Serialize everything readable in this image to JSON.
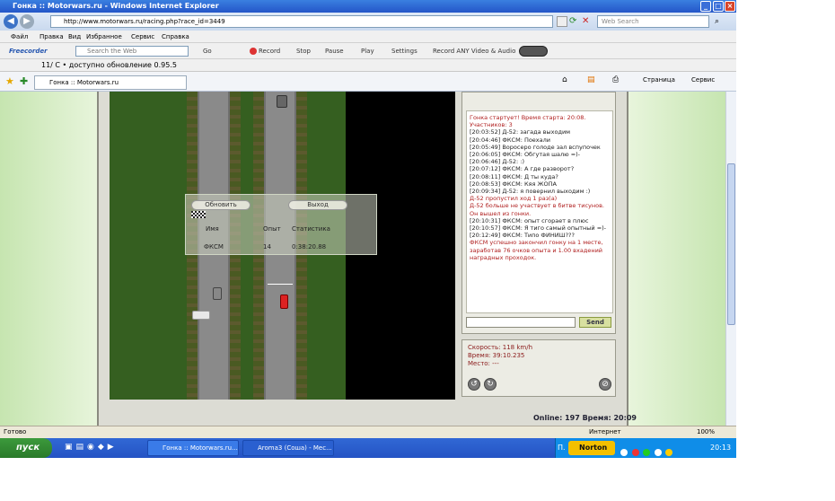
{
  "window": {
    "title": "Гонка :: Motorwars.ru - Windows Internet Explorer"
  },
  "address": {
    "url": "http://www.motorwars.ru/racing.php?race_id=3449",
    "search_placeholder": "Web Search"
  },
  "menu": [
    "Файл",
    "Правка",
    "Вид",
    "Избранное",
    "Сервис",
    "Справка"
  ],
  "toolbar": {
    "brand": "Freecorder",
    "search_placeholder": "Search the Web",
    "go": "Go",
    "record": "Record",
    "stop": "Stop",
    "pause": "Pause",
    "play": "Play",
    "settings": "Settings",
    "record_any": "Record ANY Video & Audio"
  },
  "update_bar": {
    "text": "11/ C • доступно обновление 0.95.5"
  },
  "tab": {
    "label": "Гонка :: Motorwars.ru"
  },
  "cmdbar": {
    "page": "Страница",
    "service": "Сервис"
  },
  "popup": {
    "refresh": "Обновить",
    "exit": "Выход",
    "col_name": "Имя",
    "col_exp": "Опыт",
    "col_stat": "Статистика",
    "row_name": "ФКСМ",
    "row_exp": "14",
    "row_stat": "0:38:20.88"
  },
  "chat": {
    "lines": [
      {
        "t": "Гонка стартует! Время старта: 20:08.",
        "r": true
      },
      {
        "t": "Участников: 3",
        "r": true
      },
      {
        "t": "[20:03:52] Д-52: загада выходим",
        "r": false
      },
      {
        "t": "[20:04:46] ФКСМ: Поехали",
        "r": false
      },
      {
        "t": "[20:05:49] Воросеро голоде зал вспупочек",
        "r": false
      },
      {
        "t": "[20:06:05] ФКСМ: Обгутая шалю =)-",
        "r": false
      },
      {
        "t": "[20:06:46] Д-52: :)",
        "r": false
      },
      {
        "t": "[20:07:12] ФКСМ: А где разворот?",
        "r": false
      },
      {
        "t": "[20:08:11] ФКСМ: Д ты куда?",
        "r": false
      },
      {
        "t": "[20:08:53] ФКСМ: Кяя ЖОПА",
        "r": false
      },
      {
        "t": "[20:09:34] Д-52: я повернил выходим :)",
        "r": false
      },
      {
        "t": "Д-52 пропустил ход 1 раз(а)",
        "r": true
      },
      {
        "t": "Д-52 больше не участвует в битве тисунов.",
        "r": true
      },
      {
        "t": "Он вышел из гонки.",
        "r": true
      },
      {
        "t": "[20:10:31] ФКСМ: опыт сгорает в плюс",
        "r": false
      },
      {
        "t": "[20:10:57] ФКСМ: Я тиго самый опытный =)-",
        "r": false
      },
      {
        "t": "[20:12:49] ФКСМ: Типо ФИНИШ???",
        "r": false
      },
      {
        "t": "ФКСМ успешно закончил гонку на 1 месте,",
        "r": true
      },
      {
        "t": "заработав 76 очков опыта и 1.00 вхадений",
        "r": true
      },
      {
        "t": "наградных проходок.",
        "r": true
      }
    ],
    "send": "Send"
  },
  "stats": {
    "speed": "Скорость: 118 km/h",
    "time": "Время: 39:10.235",
    "place": "Место: ---"
  },
  "online": "Online: 197  Время: 20:09",
  "status": {
    "left": "Готово",
    "zone": "Интернет",
    "zoom": "100%"
  },
  "taskbar": {
    "start": "пуск",
    "tasks": [
      "Гонка :: Motorwars.ru...",
      "Aroma3 (Соша) - Мес..."
    ],
    "lang": "П.",
    "norton": "Norton",
    "clock": "20:13"
  }
}
